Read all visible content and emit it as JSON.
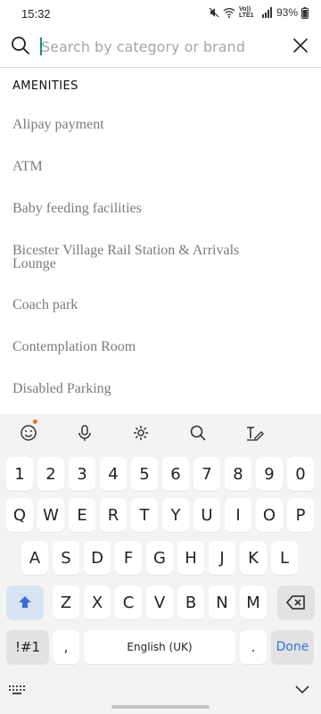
{
  "status_bar": {
    "time": "15:32",
    "network": "Vo)) LTE1",
    "battery": "93%"
  },
  "search": {
    "placeholder": "Search by category or brand",
    "value": ""
  },
  "amenities": {
    "heading": "AMENITIES",
    "items": [
      "Alipay payment",
      "ATM",
      "Baby feeding facilities",
      "Bicester Village Rail Station & Arrivals Lounge",
      "Coach park",
      "Contemplation Room",
      "Disabled Parking"
    ]
  },
  "keyboard": {
    "toolbar": [
      "emoji-icon",
      "microphone-icon",
      "settings-icon",
      "search-icon",
      "handwriting-icon"
    ],
    "rows": {
      "numbers": [
        "1",
        "2",
        "3",
        "4",
        "5",
        "6",
        "7",
        "8",
        "9",
        "0"
      ],
      "row1": [
        "Q",
        "W",
        "E",
        "R",
        "T",
        "Y",
        "U",
        "I",
        "O",
        "P"
      ],
      "row2": [
        "A",
        "S",
        "D",
        "F",
        "G",
        "H",
        "J",
        "K",
        "L"
      ],
      "row3": [
        "Z",
        "X",
        "C",
        "V",
        "B",
        "N",
        "M"
      ]
    },
    "symbols_label": "!#1",
    "comma_label": ",",
    "space_label": "English (UK)",
    "period_label": ".",
    "done_label": "Done"
  },
  "colors": {
    "accent": "#1a8c84",
    "notification_dot": "#ff6a1a",
    "done_text": "#3b6fd8"
  }
}
